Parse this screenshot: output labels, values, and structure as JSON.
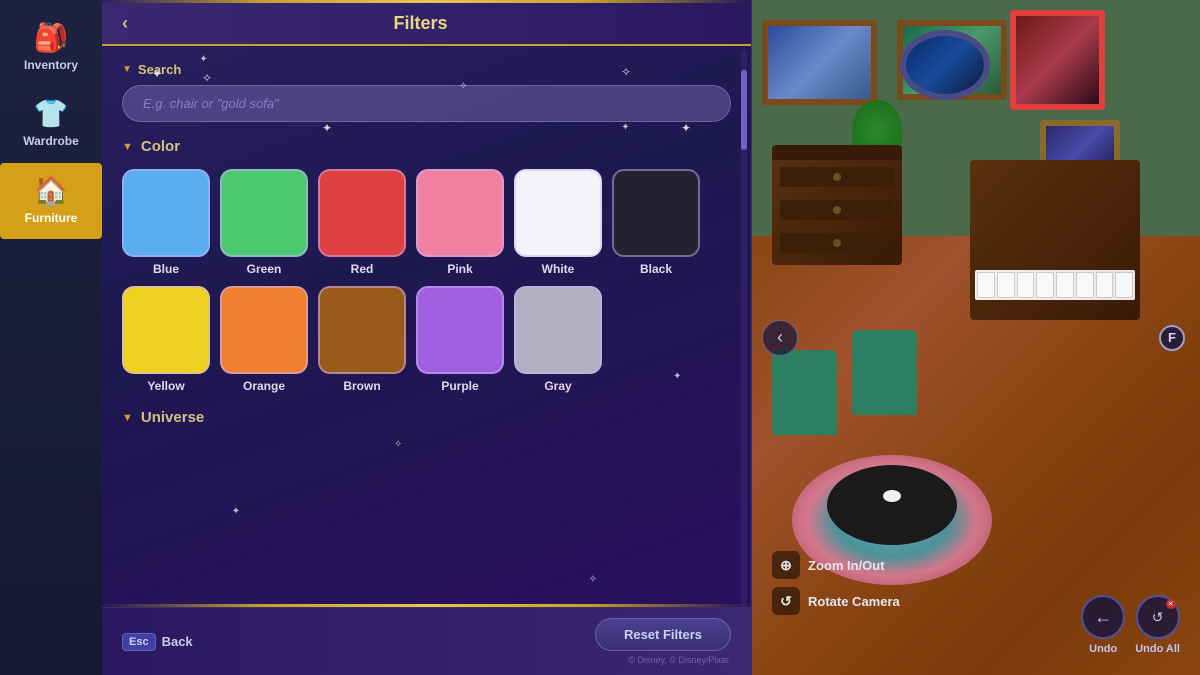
{
  "sidebar": {
    "items": [
      {
        "id": "inventory",
        "label": "Inventory",
        "icon": "🎒",
        "active": false
      },
      {
        "id": "wardrobe",
        "label": "Wardrobe",
        "icon": "👕",
        "active": false
      },
      {
        "id": "furniture",
        "label": "Furniture",
        "icon": "🏠",
        "active": true
      }
    ]
  },
  "panel": {
    "title": "Filters",
    "back_label": "‹",
    "search": {
      "label": "Search",
      "placeholder": "E.g. chair or \"gold sofa\""
    },
    "color_section_label": "Color",
    "universe_section_label": "Universe",
    "colors": [
      {
        "id": "blue",
        "label": "Blue",
        "hex": "#5aadee",
        "selected": false
      },
      {
        "id": "green",
        "label": "Green",
        "hex": "#4cc970",
        "selected": false
      },
      {
        "id": "red",
        "label": "Red",
        "hex": "#e04040",
        "selected": false
      },
      {
        "id": "pink",
        "label": "Pink",
        "hex": "#f080a0",
        "selected": false
      },
      {
        "id": "white",
        "label": "White",
        "hex": "#f4f4f8",
        "selected": false
      },
      {
        "id": "black",
        "label": "Black",
        "hex": "#222230",
        "selected": false
      },
      {
        "id": "yellow",
        "label": "Yellow",
        "hex": "#f0d020",
        "selected": false
      },
      {
        "id": "orange",
        "label": "Orange",
        "hex": "#f08030",
        "selected": false
      },
      {
        "id": "brown",
        "label": "Brown",
        "hex": "#9a5a1a",
        "selected": false
      },
      {
        "id": "purple",
        "label": "Purple",
        "hex": "#a060e0",
        "selected": false
      },
      {
        "id": "gray",
        "label": "Gray",
        "hex": "#b0b0c0",
        "selected": false
      }
    ],
    "footer": {
      "esc_label": "Esc",
      "back_label": "Back",
      "reset_label": "Reset Filters",
      "copyright": "© Disney, © Disney/Pixar."
    }
  },
  "game": {
    "nav_left_icon": "‹",
    "f_badge": "F",
    "controls": [
      {
        "icon": "⊕",
        "label": "Zoom In/Out"
      },
      {
        "icon": "↺",
        "label": "Rotate Camera"
      }
    ],
    "undo_label": "Undo",
    "undo_all_label": "Undo All"
  }
}
